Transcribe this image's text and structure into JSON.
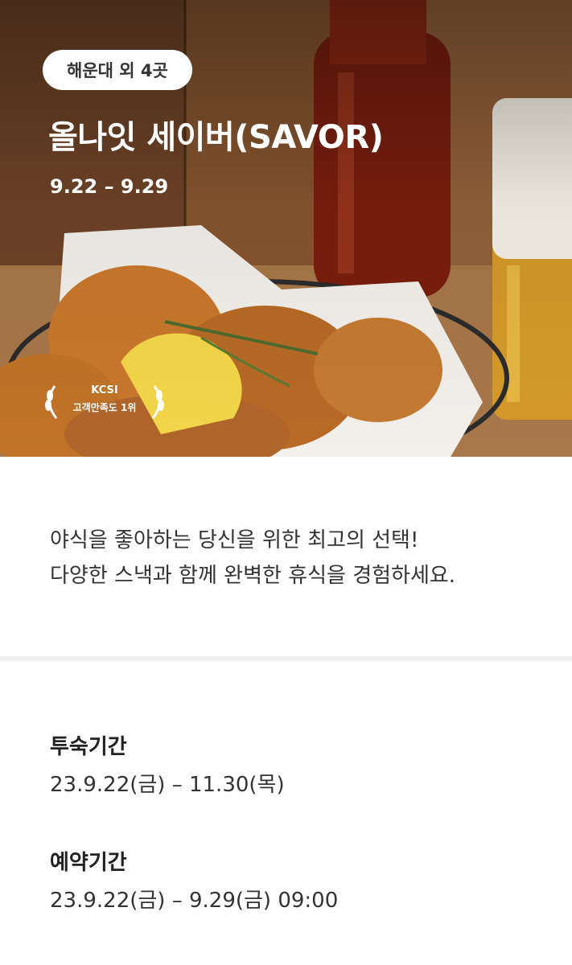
{
  "hero": {
    "location": "해운대 외 4곳",
    "title": "올나잇 세이버(SAVOR)",
    "dates": "9.22 – 9.29",
    "badge": {
      "top": "KCSI",
      "bottom": "고객만족도 1위"
    }
  },
  "description": [
    "야식을 좋아하는 당신을 위한 최고의 선택!",
    "다양한 스낵과 함께 완벽한 휴식을 경험하세요."
  ],
  "stay_period": {
    "label": "투숙기간",
    "value": "23.9.22(금) – 11.30(목)"
  },
  "booking_period": {
    "label": "예약기간",
    "value": "23.9.22(금) – 9.29(금) 09:00"
  }
}
